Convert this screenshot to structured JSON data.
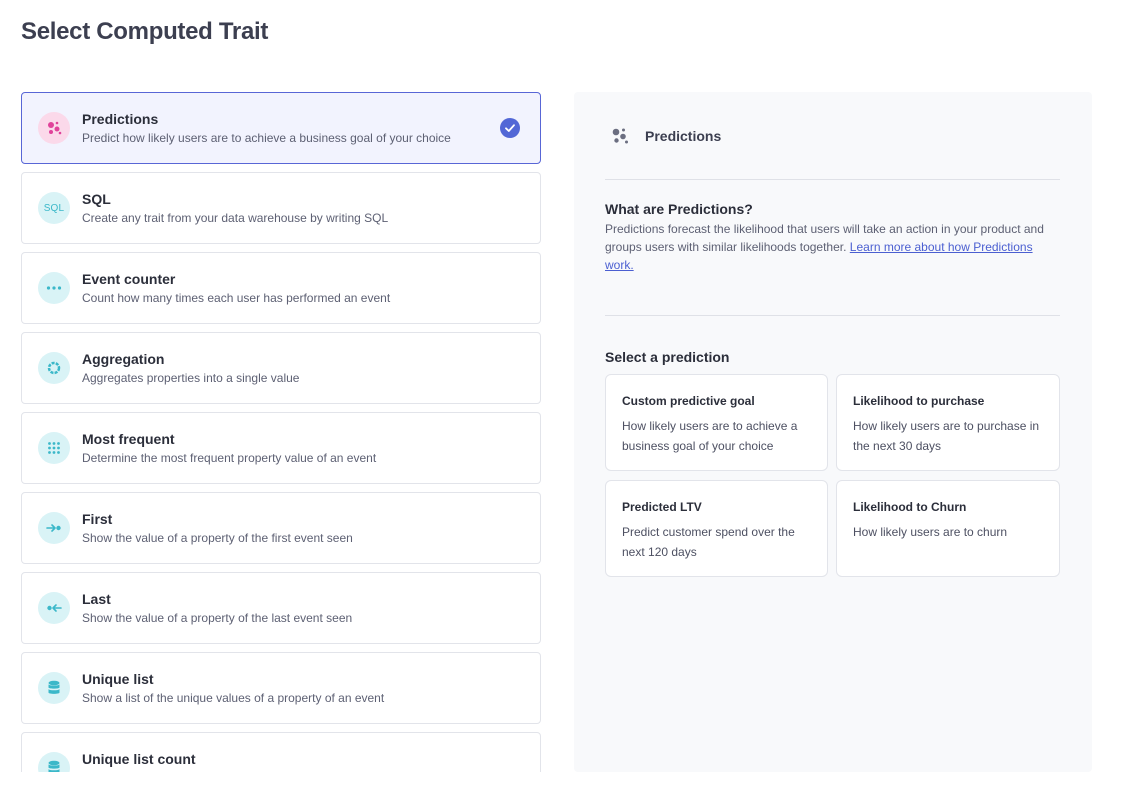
{
  "page": {
    "title": "Select Computed Trait"
  },
  "traits": [
    {
      "title": "Predictions",
      "description": "Predict how likely users are to achieve a business goal of your choice",
      "icon": "predictions-icon",
      "selected": true
    },
    {
      "title": "SQL",
      "description": "Create any trait from your data warehouse by writing SQL",
      "icon": "sql-icon",
      "icon_text": "SQL"
    },
    {
      "title": "Event counter",
      "description": "Count how many times each user has performed an event",
      "icon": "dots-icon"
    },
    {
      "title": "Aggregation",
      "description": "Aggregates properties into a single value",
      "icon": "gear-icon"
    },
    {
      "title": "Most frequent",
      "description": "Determine the most frequent property value of an event",
      "icon": "grid-icon"
    },
    {
      "title": "First",
      "description": "Show the value of a property of the first event seen",
      "icon": "arrow-right-icon"
    },
    {
      "title": "Last",
      "description": "Show the value of a property of the last event seen",
      "icon": "arrow-left-icon"
    },
    {
      "title": "Unique list",
      "description": "Show a list of the unique values of a property of an event",
      "icon": "database-icon"
    },
    {
      "title": "Unique list count",
      "description": "",
      "icon": "database-icon"
    }
  ],
  "detail": {
    "header_title": "Predictions",
    "what_title": "What are Predictions?",
    "what_body": "Predictions forecast the likelihood that users will take an action in your product and groups users with similar likelihoods together.",
    "learn_more": "Learn more about how Predictions work.",
    "select_title": "Select a prediction",
    "predictions": [
      {
        "title": "Custom predictive goal",
        "description": "How likely users are to achieve a business goal of your choice"
      },
      {
        "title": "Likelihood to purchase",
        "description": "How likely users are to purchase in the next 30 days"
      },
      {
        "title": "Predicted LTV",
        "description": "Predict customer spend over the next 120 days"
      },
      {
        "title": "Likelihood to Churn",
        "description": "How likely users are to churn"
      }
    ]
  },
  "colors": {
    "accent": "#5267d6",
    "selected_bg": "#f2f3fe",
    "icon_bg": "#d9f3f6",
    "icon_fg": "#3bb8c9",
    "pink": "#e0429a"
  }
}
